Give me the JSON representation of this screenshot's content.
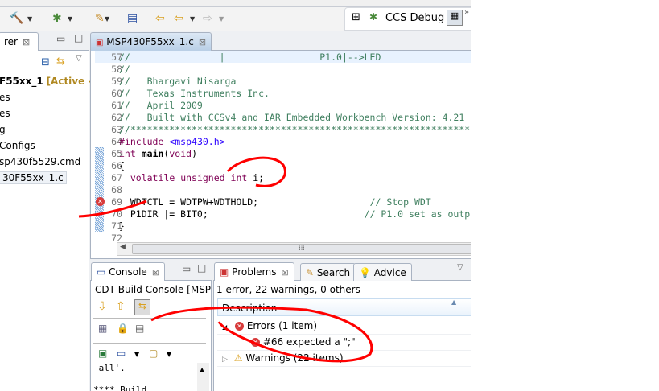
{
  "toolbar": {
    "perspective": "CCS Debug",
    "more": "»"
  },
  "explorer": {
    "tab": "rer",
    "items": [
      "F55xx_1",
      "[Active - D",
      "es",
      "es",
      "g",
      "Configs",
      "sp430f5529.cmd",
      "30F55xx_1.c"
    ]
  },
  "editor": {
    "tab": "MSP430F55xx_1.c",
    "lines": [
      {
        "n": "57",
        "t": "//                |                 P1.0|-->LED"
      },
      {
        "n": "58",
        "t": "//"
      },
      {
        "n": "59",
        "t": "//   Bhargavi Nisarga"
      },
      {
        "n": "60",
        "t": "//   Texas Instruments Inc."
      },
      {
        "n": "61",
        "t": "//   April 2009"
      },
      {
        "n": "62",
        "t": "//   Built with CCSv4 and IAR Embedded Workbench Version: 4.21"
      },
      {
        "n": "63",
        "t": "//******************************************************************"
      },
      {
        "n": "64",
        "t": "#include <msp430.h>"
      },
      {
        "n": "65",
        "t": "int main(void)"
      },
      {
        "n": "66",
        "t": "{"
      },
      {
        "n": "67",
        "t": "  volatile unsigned int i;"
      },
      {
        "n": "68",
        "t": ""
      },
      {
        "n": "69",
        "t": "  WDTCTL = WDTPW+WDTHOLD;                    // Stop WDT"
      },
      {
        "n": "70",
        "t": "  P1DIR |= BIT0;                            // P1.0 set as outp"
      },
      {
        "n": "71",
        "t": "}"
      },
      {
        "n": "72",
        "t": ""
      }
    ]
  },
  "console": {
    "tab": "Console",
    "title": "CDT Build Console [MSP",
    "out1": " all'.",
    "out2": "**** Build"
  },
  "problems": {
    "tabs": [
      "Problems",
      "Search",
      "Advice"
    ],
    "summary": "1 error, 22 warnings, 0 others",
    "column": "Description",
    "errors": "Errors (1 item)",
    "error1": "#66 expected a \";\"",
    "warnings": "Warnings (22 items)"
  },
  "colors": {
    "annotation": "#ff0000"
  }
}
